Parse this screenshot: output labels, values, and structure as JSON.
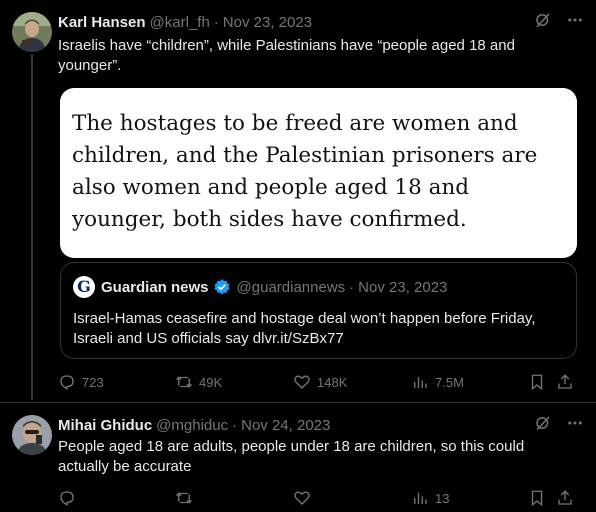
{
  "tweet1": {
    "author_name": "Karl Hansen",
    "handle": "@karl_fh",
    "separator": "·",
    "date": "Nov 23, 2023",
    "text": "Israelis have “children”, while Palestinians have “people aged 18 and younger”.",
    "media_text": "The hostages to be freed are women and children, and the Palestinian prisoners are also women and people aged 18 and younger, both sides have confirmed.",
    "quote": {
      "logo_letter": "G",
      "author_name": "Guardian news",
      "handle": "@guardiannews",
      "separator": "·",
      "date": "Nov 23, 2023",
      "text": "Israel-Hamas ceasefire and hostage deal won’t happen before Friday, Israeli and US officials say dlvr.it/SzBx77"
    },
    "stats": {
      "replies": "723",
      "reposts": "49K",
      "likes": "148K",
      "views": "7.5M"
    }
  },
  "tweet2": {
    "author_name": "Mihai Ghiduc",
    "handle": "@mghiduc",
    "separator": "·",
    "date": "Nov 24, 2023",
    "text": "People aged 18 are adults, people under 18 are children, so this could actually be accurate",
    "stats": {
      "replies": "",
      "reposts": "",
      "likes": "",
      "views": "13"
    }
  },
  "icons": {
    "grok": "grok-icon",
    "more": "more-icon",
    "reply": "reply-icon",
    "repost": "repost-icon",
    "like": "like-icon",
    "views": "views-icon",
    "bookmark": "bookmark-icon",
    "share": "share-icon",
    "verified": "verified-badge-icon"
  },
  "colors": {
    "background": "#000000",
    "text": "#e7e9ea",
    "secondary": "#71767b",
    "border": "#2f3336",
    "verified": "#1d9bf0"
  }
}
